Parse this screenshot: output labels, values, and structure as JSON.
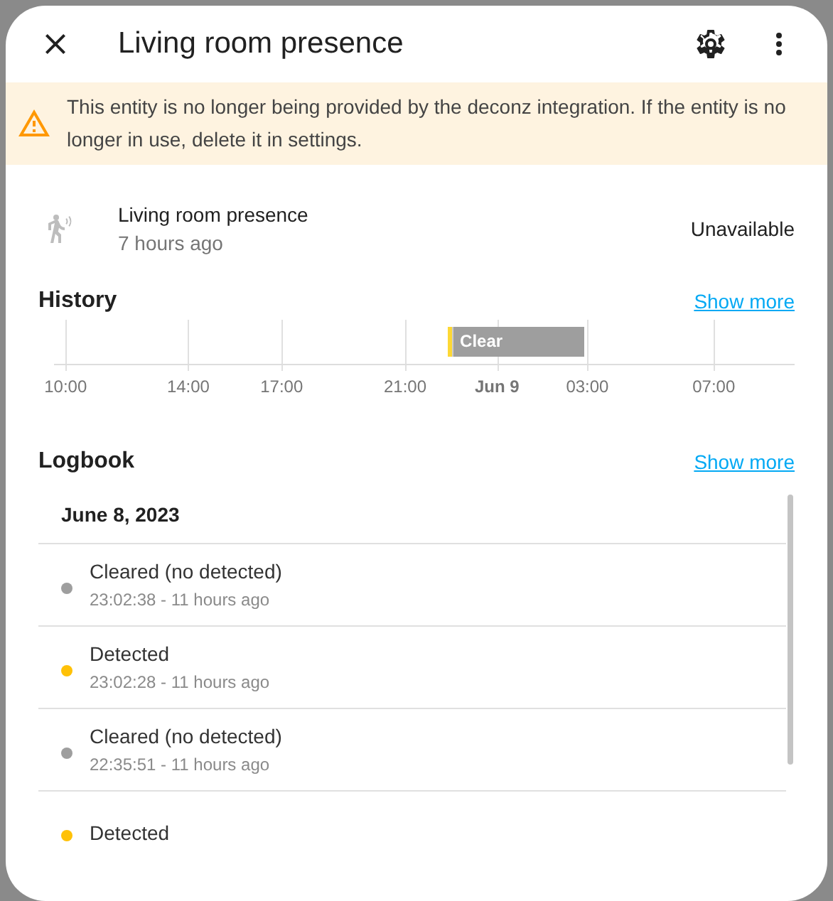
{
  "dialog": {
    "title": "Living room presence"
  },
  "warning": {
    "text": "This entity is no longer being provided by the deconz integration. If the entity is no longer in use, delete it in settings."
  },
  "entity": {
    "name": "Living room presence",
    "changed": "7 hours ago",
    "state": "Unavailable"
  },
  "history": {
    "title": "History",
    "link": "Show more",
    "ticks": [
      {
        "label": "10:00",
        "bold": false
      },
      {
        "label": "14:00",
        "bold": false
      },
      {
        "label": "17:00",
        "bold": false
      },
      {
        "label": "21:00",
        "bold": false
      },
      {
        "label": "Jun 9",
        "bold": true
      },
      {
        "label": "03:00",
        "bold": false
      },
      {
        "label": "07:00",
        "bold": false
      }
    ],
    "segments": [
      {
        "kind": "detected",
        "color": "#fdd835"
      },
      {
        "kind": "clear",
        "color": "#9e9e9e",
        "label": "Clear"
      }
    ]
  },
  "logbook": {
    "title": "Logbook",
    "link": "Show more",
    "date": "June 8, 2023",
    "entries": [
      {
        "message": "Cleared (no detected)",
        "time": "23:02:38 - 11 hours ago",
        "color": "#9e9e9e"
      },
      {
        "message": "Detected",
        "time": "23:02:28 - 11 hours ago",
        "color": "#ffc107"
      },
      {
        "message": "Cleared (no detected)",
        "time": "22:35:51 - 11 hours ago",
        "color": "#9e9e9e"
      },
      {
        "message": "Detected",
        "color": "#ffc107"
      }
    ]
  }
}
